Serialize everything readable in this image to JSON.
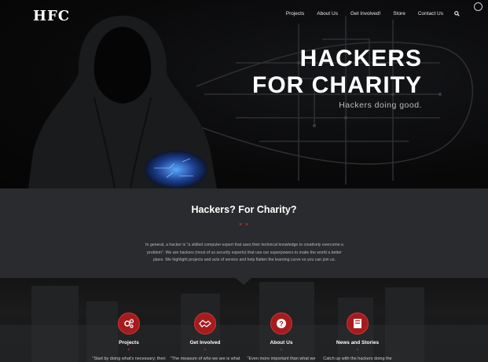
{
  "brand": {
    "logo_text": "HFC"
  },
  "nav": {
    "items": [
      "Projects",
      "About Us",
      "Get Involved!",
      "Store",
      "Contact Us"
    ],
    "search_icon": "search-icon"
  },
  "hero": {
    "title_line1": "HACKERS",
    "title_line2": "FOR CHARITY",
    "subtitle": "Hackers doing good."
  },
  "intro": {
    "title": "Hackers? For Charity?",
    "divider": "× ×",
    "text": "In general, a hacker is \"a skilled computer expert that uses their technical knowledge to creatively overcome a problem\". We are hackers (most of us security experts) that use our superpowers to make the world a better place. We highlight projects and acts of service and help flatten the learning curve so you can join us."
  },
  "features": [
    {
      "title": "Projects",
      "divider": "×",
      "text": "\"Start by doing what's necessary; then",
      "icon": "gears-icon"
    },
    {
      "title": "Get Involved",
      "divider": "×",
      "text": "\"The measure of who we are is what",
      "icon": "handshake-icon"
    },
    {
      "title": "About Us",
      "divider": "×",
      "text": "\"Even more important than what we",
      "icon": "question-icon"
    },
    {
      "title": "News and Stories",
      "divider": "×",
      "text": "Catch up with the hackers doing the",
      "icon": "book-icon"
    }
  ],
  "colors": {
    "accent": "#a51c1f",
    "intro_bg": "#2a2b2e"
  }
}
